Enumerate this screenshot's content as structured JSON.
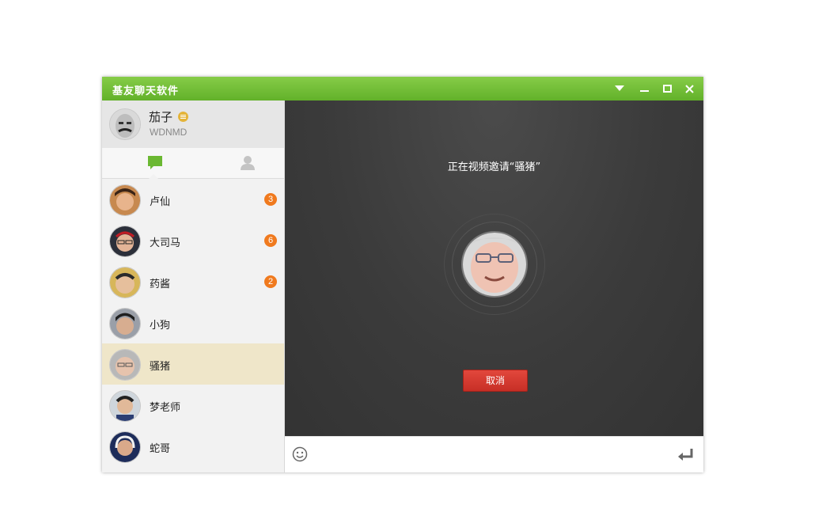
{
  "window": {
    "title": "基友聊天软件",
    "accent_color": "#6bb832"
  },
  "titlebar": {
    "controls": [
      "dropdown-icon",
      "minimize-icon",
      "maximize-icon",
      "close-icon"
    ]
  },
  "profile": {
    "name": "茄子",
    "signature": "WDNMD",
    "status_color": "#e4b43a"
  },
  "tabs": [
    {
      "icon": "chat-bubble-icon",
      "active": true
    },
    {
      "icon": "contacts-icon",
      "active": false
    }
  ],
  "contacts": [
    {
      "name": "卢仙",
      "unread": "3"
    },
    {
      "name": "大司马",
      "unread": "6"
    },
    {
      "name": "药酱",
      "unread": "2"
    },
    {
      "name": "小狗",
      "unread": ""
    },
    {
      "name": "骚猪",
      "unread": "",
      "active": true
    },
    {
      "name": "梦老师",
      "unread": ""
    },
    {
      "name": "蛇哥",
      "unread": ""
    }
  ],
  "call": {
    "invite_text": "正在视频邀请“骚猪”",
    "cancel_label": "取消",
    "cancel_color": "#d63a30"
  },
  "input_bar": {
    "icons": [
      "emoji-icon",
      "enter-icon"
    ]
  }
}
